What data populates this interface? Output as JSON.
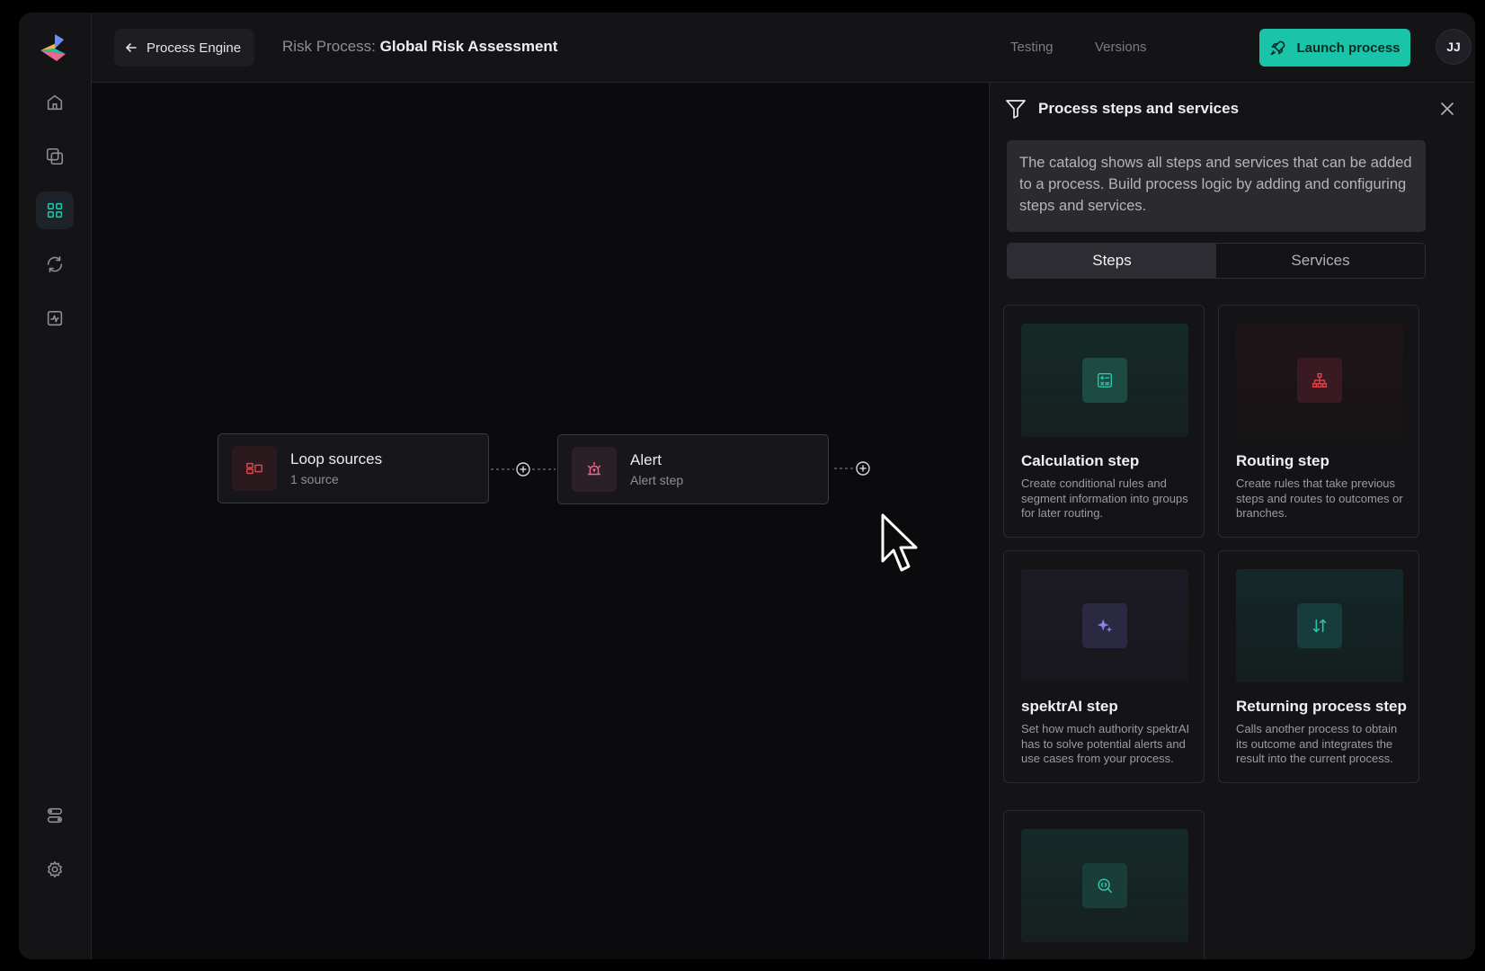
{
  "header": {
    "back_label": "Process Engine",
    "breadcrumb_prefix": "Risk Process:",
    "process_name": "Global Risk Assessment",
    "testing_label": "Testing",
    "versions_label": "Versions",
    "launch_label": "Launch process",
    "avatar_initials": "JJ"
  },
  "canvas": {
    "nodes": [
      {
        "title": "Loop sources",
        "subtitle": "1 source",
        "icon": "loop-sources-icon"
      },
      {
        "title": "Alert",
        "subtitle": "Alert step",
        "icon": "alarm-icon"
      }
    ]
  },
  "panel": {
    "title": "Process steps and services",
    "info": "The catalog shows all steps and services that can be added to a process. Build process logic by adding and configuring steps and services.",
    "tabs": [
      {
        "label": "Steps",
        "active": true
      },
      {
        "label": "Services",
        "active": false
      }
    ],
    "cards": [
      {
        "title": "Calculation step",
        "description": "Create conditional rules and segment information into groups for later routing.",
        "icon": "calculator-icon"
      },
      {
        "title": "Routing step",
        "description": "Create rules that take previous steps and routes to outcomes or branches.",
        "icon": "hierarchy-icon"
      },
      {
        "title": "spektrAI step",
        "description": "Set how much authority spektrAI has to solve potential alerts and use cases from your process.",
        "icon": "sparkles-icon"
      },
      {
        "title": "Returning process step",
        "description": "Calls another process to obtain its outcome and integrates the result into the current process.",
        "icon": "arrows-up-down-icon"
      },
      {
        "title": "",
        "description": "",
        "icon": "search-code-icon"
      }
    ]
  },
  "colors": {
    "accent": "#19c4a8",
    "background": "#0b0b0e",
    "panel": "#141417",
    "loop_icon": "#e0434a",
    "alert_icon": "#e86a8a",
    "calc_icon": "#2ec4a7",
    "routing_icon": "#e0434a",
    "ai_icon": "#8a83e8",
    "return_icon": "#2ec4a7"
  }
}
